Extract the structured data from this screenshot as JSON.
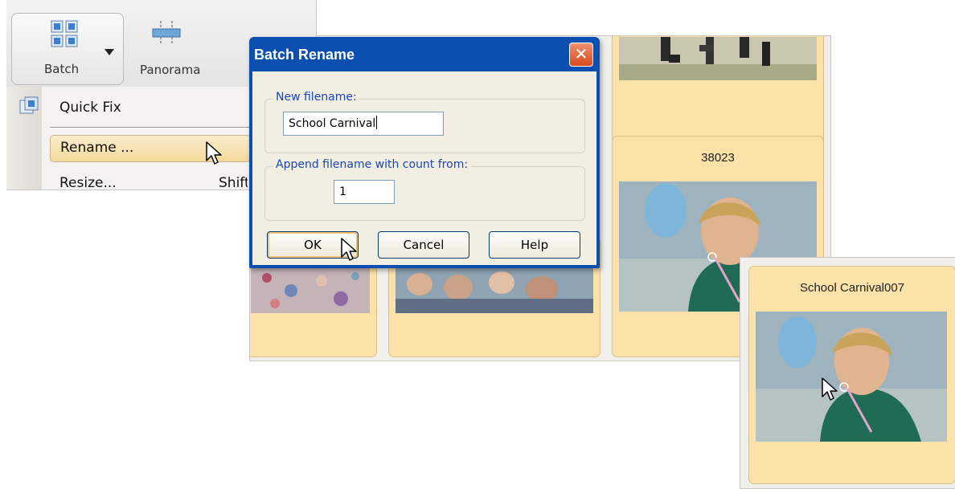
{
  "toolbar": {
    "batch_label": "Batch",
    "panorama_label": "Panorama"
  },
  "batch_menu": {
    "items": [
      {
        "label": "Quick Fix"
      },
      {
        "label": "Rename ..."
      },
      {
        "label": "Resize..."
      }
    ],
    "resize_shortcut": "Shift"
  },
  "grid": {
    "thumbnails": [
      {
        "name": "38023"
      }
    ]
  },
  "dialog": {
    "title": "Batch Rename",
    "close_glyph": "✕",
    "new_filename_label": "New filename:",
    "new_filename_value": "School Carnival",
    "append_label": "Append filename with count from:",
    "count_value": "1",
    "ok_label": "OK",
    "cancel_label": "Cancel",
    "help_label": "Help"
  },
  "result": {
    "name": "School Carnival007"
  },
  "colors": {
    "dialog_titlebar": "#0b4fb0",
    "dialog_body": "#f1efe2",
    "legend_text": "#1c45b5",
    "thumbnail_card": "#fbe2a8",
    "menu_highlight": "#f3d89a",
    "close_button": "#d84a1c"
  },
  "icons": [
    "batch-icon",
    "chevron-down-icon",
    "panorama-icon",
    "quick-fix-icon",
    "close-icon",
    "mouse-pointer-icon"
  ]
}
